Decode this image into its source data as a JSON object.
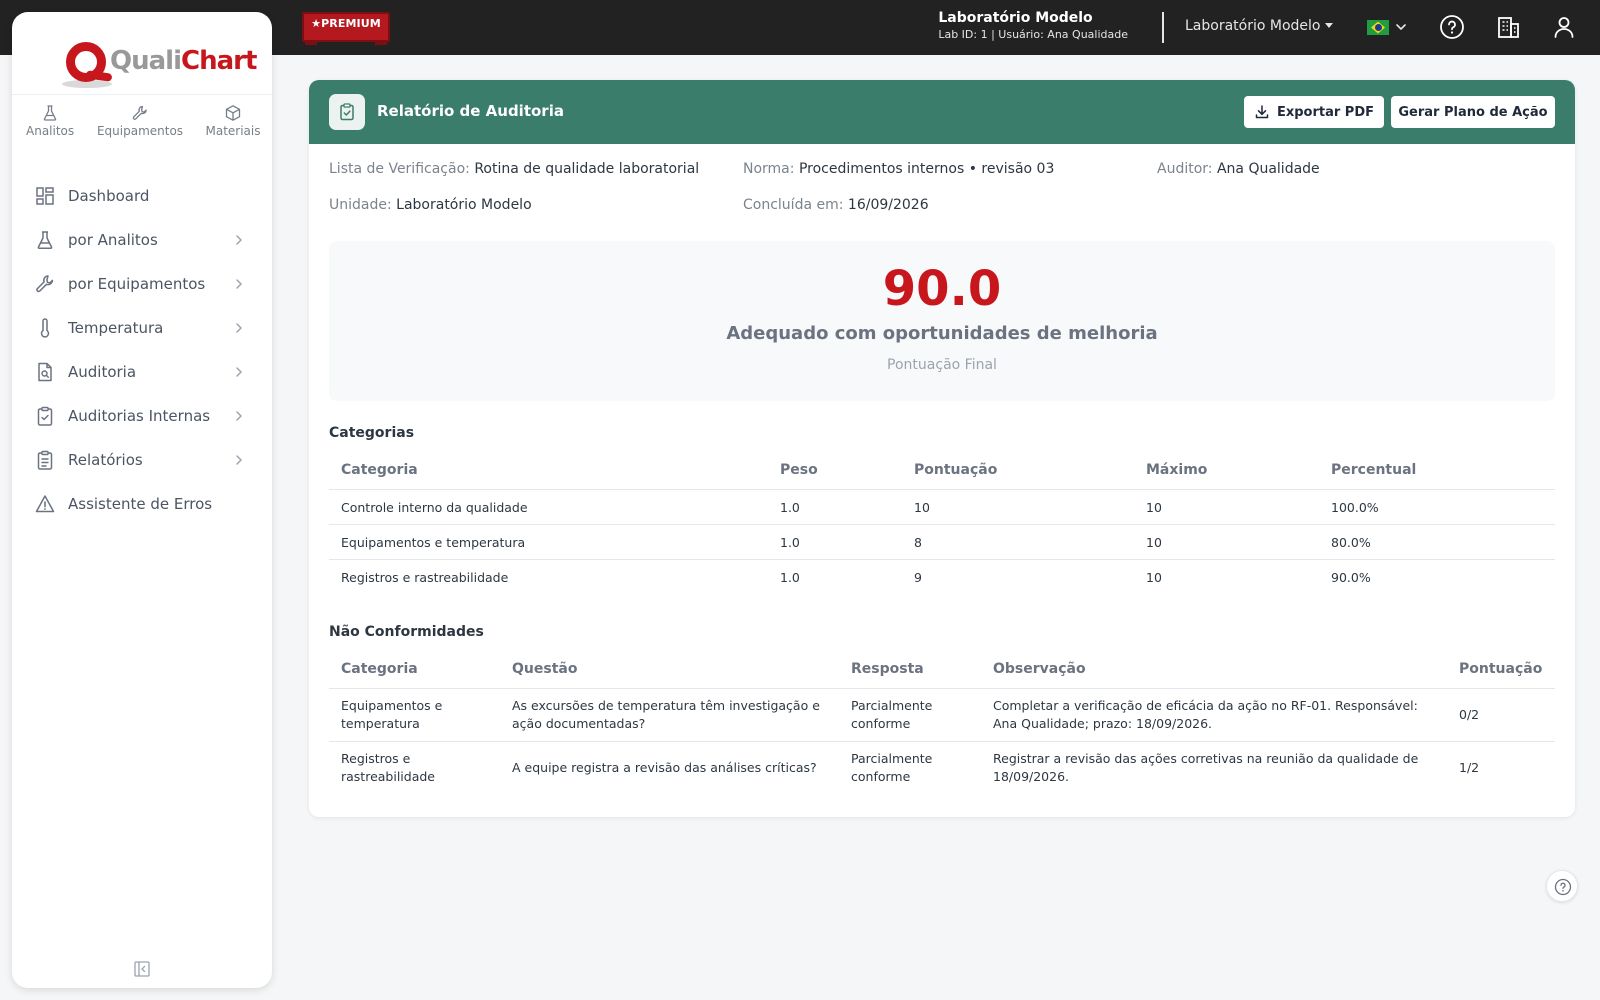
{
  "topbar": {
    "premium_label": "★PREMIUM",
    "lab_name": "Laboratório Modelo",
    "lab_meta": "Lab ID: 1 | Usuário: Ana Qualidade",
    "lab_select": "Laboratório Modelo",
    "icons": [
      "flag-brazil-icon",
      "help-icon",
      "building-icon",
      "user-icon"
    ]
  },
  "sidebar": {
    "logo_text_muted": "Quali",
    "logo_text_accent": "Chart",
    "quick_nav": [
      {
        "label": "Analitos",
        "icon": "flask-icon"
      },
      {
        "label": "Equipamentos",
        "icon": "wrench-icon"
      },
      {
        "label": "Materiais",
        "icon": "box-icon"
      }
    ],
    "menu": [
      {
        "label": "Dashboard",
        "icon": "dashboard-icon",
        "has_children": false
      },
      {
        "label": "por Analitos",
        "icon": "flask-icon",
        "has_children": true
      },
      {
        "label": "por Equipamentos",
        "icon": "wrench-icon",
        "has_children": true
      },
      {
        "label": "Temperatura",
        "icon": "thermometer-icon",
        "has_children": true
      },
      {
        "label": "Auditoria",
        "icon": "document-search-icon",
        "has_children": true
      },
      {
        "label": "Auditorias Internas",
        "icon": "clipboard-check-icon",
        "has_children": true
      },
      {
        "label": "Relatórios",
        "icon": "clipboard-list-icon",
        "has_children": true
      },
      {
        "label": "Assistente de Erros",
        "icon": "warning-icon",
        "has_children": false
      }
    ]
  },
  "report": {
    "title": "Relatório de Auditoria",
    "export_pdf": "Exportar PDF",
    "action_plan": "Gerar Plano de Ação",
    "meta": {
      "checklist_label": "Lista de Verificação:",
      "checklist_value": "Rotina de qualidade laboratorial",
      "norm_label": "Norma:",
      "norm_value": "Procedimentos internos • revisão 03",
      "auditor_label": "Auditor:",
      "auditor_value": "Ana Qualidade",
      "unit_label": "Unidade:",
      "unit_value": "Laboratório Modelo",
      "completed_label": "Concluída em:",
      "completed_value": "16/09/2026"
    },
    "score": {
      "value": "90.0",
      "label": "Adequado com oportunidades de melhoria",
      "caption": "Pontuação Final"
    },
    "categories": {
      "title": "Categorias",
      "headers": [
        "Categoria",
        "Peso",
        "Pontuação",
        "Máximo",
        "Percentual"
      ],
      "rows": [
        [
          "Controle interno da qualidade",
          "1.0",
          "10",
          "10",
          "100.0%"
        ],
        [
          "Equipamentos e temperatura",
          "1.0",
          "8",
          "10",
          "80.0%"
        ],
        [
          "Registros e rastreabilidade",
          "1.0",
          "9",
          "10",
          "90.0%"
        ]
      ]
    },
    "nonconformities": {
      "title": "Não Conformidades",
      "headers": [
        "Categoria",
        "Questão",
        "Resposta",
        "Observação",
        "Pontuação"
      ],
      "rows": [
        [
          "Equipamentos e temperatura",
          "As excursões de temperatura têm investigação e ação documentadas?",
          "Parcialmente conforme",
          "Completar a verificação de eficácia da ação no RF-01. Responsável: Ana Qualidade; prazo: 18/09/2026.",
          "0/2"
        ],
        [
          "Registros e rastreabilidade",
          "A equipe registra a revisão das análises críticas?",
          "Parcialmente conforme",
          "Registrar a revisão das ações corretivas na reunião da qualidade de 18/09/2026.",
          "1/2"
        ]
      ]
    }
  },
  "colors": {
    "header_green": "#3a7d6a",
    "score_red": "#c8161d",
    "topbar": "#222222"
  }
}
